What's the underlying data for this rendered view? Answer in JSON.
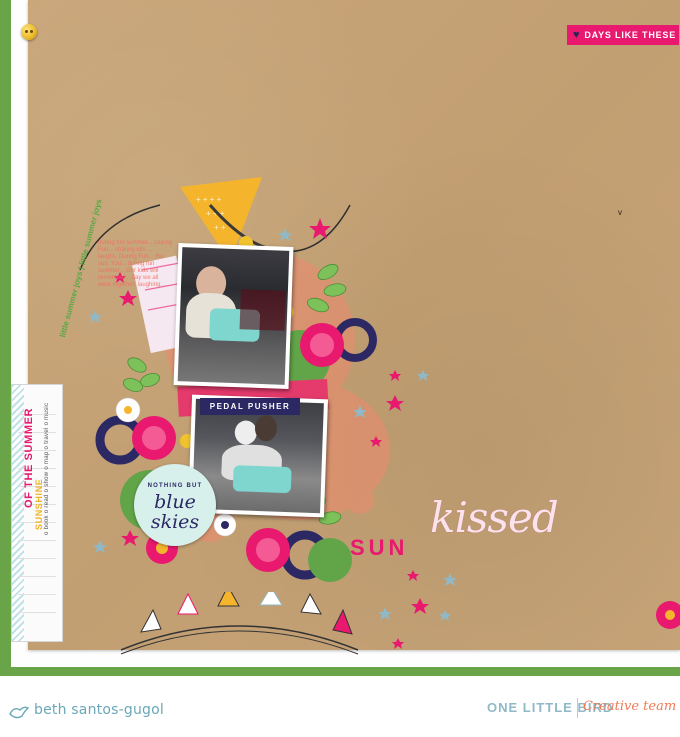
{
  "tag": {
    "label": "DAYS LIKE THESE"
  },
  "photo_labels": {
    "pedal_pusher": "PEDAL PUSHER",
    "skies_top": "NOTHING BUT",
    "skies_main": "blue skies"
  },
  "title": {
    "sun": "SUN",
    "kissed": "kissed"
  },
  "arc_text": "little summer joys | little summer joys",
  "journal_text": "during fun summer... During Fun... sharing lots ... laughs. During Fun... the sun. You... during fun summer... Our kids will remember... day we all were together, laughing, ...",
  "side_card": {
    "title": "OF THE SUMMER",
    "sunshine": "SUNSHINE",
    "list": [
      "o book",
      "o read",
      "o show",
      "o map",
      "o travel",
      "o music"
    ]
  },
  "footer": {
    "author": "beth santos-gugol",
    "brand": "ONE LITTLE BIRD",
    "team": "Creative team"
  },
  "colors": {
    "kraft": "#c5a275",
    "green_frame": "#69a548",
    "pink": "#e8196e",
    "navy": "#2b2864",
    "teal": "#6aa7b8",
    "coral": "#ef7a57"
  },
  "icons": [
    "heart-icon",
    "star-icon",
    "flower-icon",
    "leaf-icon",
    "button-icon",
    "bird-logo-icon"
  ]
}
